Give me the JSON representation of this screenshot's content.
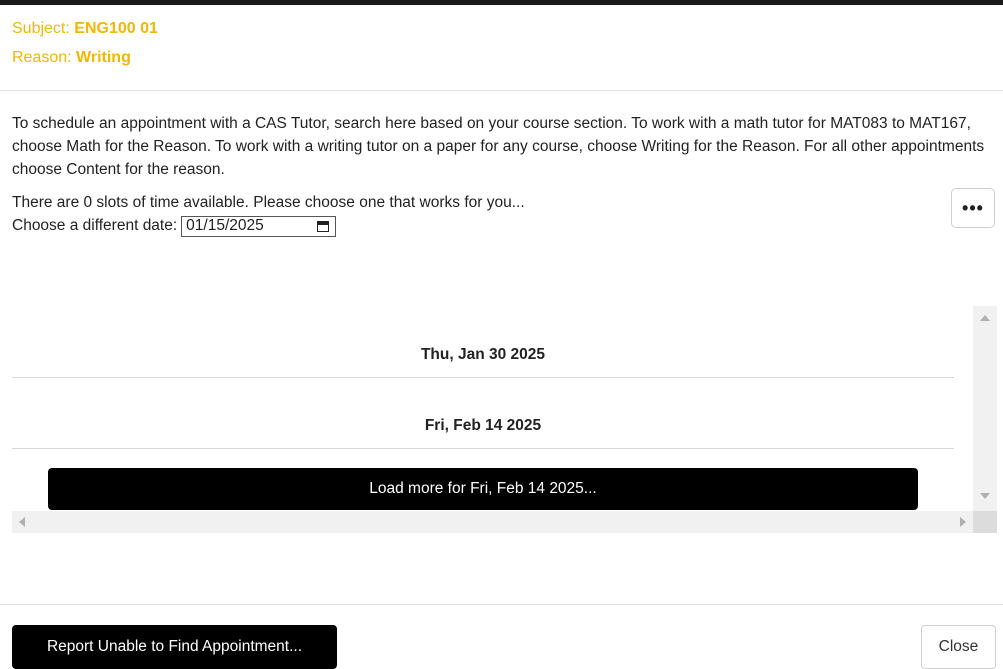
{
  "header": {
    "subject_label": "Subject:",
    "subject_value": "ENG100 01",
    "reason_label": "Reason:",
    "reason_value": "Writing"
  },
  "intro": {
    "description": "To schedule an appointment with a CAS Tutor, search here based on your course section. To work with a math tutor for MAT083 to MAT167, choose Math for the Reason. To work with a writing tutor on a paper for any course, choose Writing for the Reason. For all other appointments choose Content for the reason.",
    "slots_text": "There are 0 slots of time available. Please choose one that works for you...",
    "date_label": "Choose a different date:",
    "date_value": "01/15/2025"
  },
  "more_button": {
    "label": "•••",
    "icon": "ellipsis-icon"
  },
  "schedule": {
    "days": [
      {
        "label": "Thu, Jan 30 2025"
      },
      {
        "label": "Fri, Feb 14 2025"
      }
    ],
    "load_more_label": "Load more for Fri, Feb 14 2025..."
  },
  "footer": {
    "report_label": "Report Unable to Find Appointment...",
    "close_label": "Close"
  },
  "colors": {
    "accent": "#f2b705",
    "button_dark": "#000000",
    "text": "#222222"
  }
}
